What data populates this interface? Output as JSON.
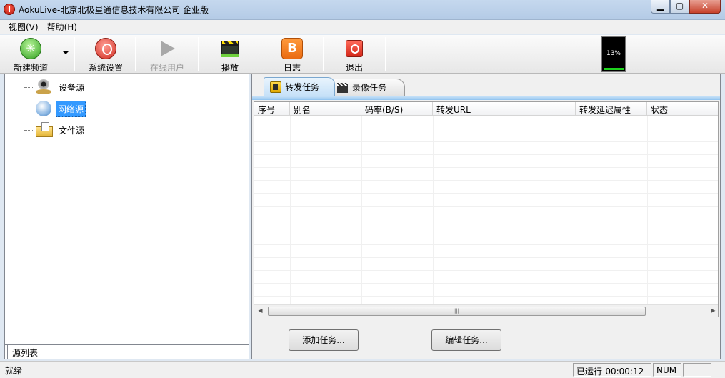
{
  "window": {
    "title": "AokuLive-北京北极星通信息技术有限公司 企业版",
    "controls": {
      "minimize": "▁",
      "maximize": "▢",
      "close": "✕"
    }
  },
  "menubar": {
    "items": [
      {
        "label": "视图(V)"
      },
      {
        "label": "帮助(H)"
      }
    ]
  },
  "toolbar": {
    "new_channel": {
      "label": "新建频道",
      "icon": "new-channel-icon"
    },
    "settings": {
      "label": "系统设置",
      "icon": "power-settings-icon"
    },
    "online_users": {
      "label": "在线用户",
      "icon": "play-arrow-icon",
      "disabled": true
    },
    "play": {
      "label": "播放",
      "icon": "clapperboard-icon"
    },
    "log": {
      "label": "日志",
      "icon": "blogger-icon"
    },
    "exit": {
      "label": "退出",
      "icon": "power-icon"
    },
    "cpu_meter": {
      "text": "13%",
      "value": 0.13
    }
  },
  "left_panel": {
    "tree": [
      {
        "label": "设备源",
        "icon": "webcam-icon"
      },
      {
        "label": "网络源",
        "icon": "globe-icon",
        "selected": true
      },
      {
        "label": "文件源",
        "icon": "folder-file-icon"
      }
    ],
    "tab_label": "源列表"
  },
  "right_panel": {
    "tabs": [
      {
        "label": "转发任务",
        "icon": "forward-task-icon",
        "active": true
      },
      {
        "label": "录像任务",
        "icon": "clapper-icon",
        "active": false
      }
    ],
    "grid": {
      "columns": [
        "序号",
        "别名",
        "码率(B/S)",
        "转发URL",
        "转发延迟属性",
        "状态"
      ],
      "rows": []
    },
    "scrollbar": {
      "left_arrow": "◀",
      "right_arrow": "▶",
      "thumb_grip": "|||"
    },
    "buttons": {
      "add_task": "添加任务...",
      "edit_task": "编辑任务..."
    }
  },
  "statusbar": {
    "ready": "就绪",
    "runtime": "已运行-00:00:12",
    "num": "NUM"
  },
  "colors": {
    "selection": "#3399ff",
    "cpu_fill": "#1ed31e",
    "tab_active": "#c6e1f8"
  }
}
